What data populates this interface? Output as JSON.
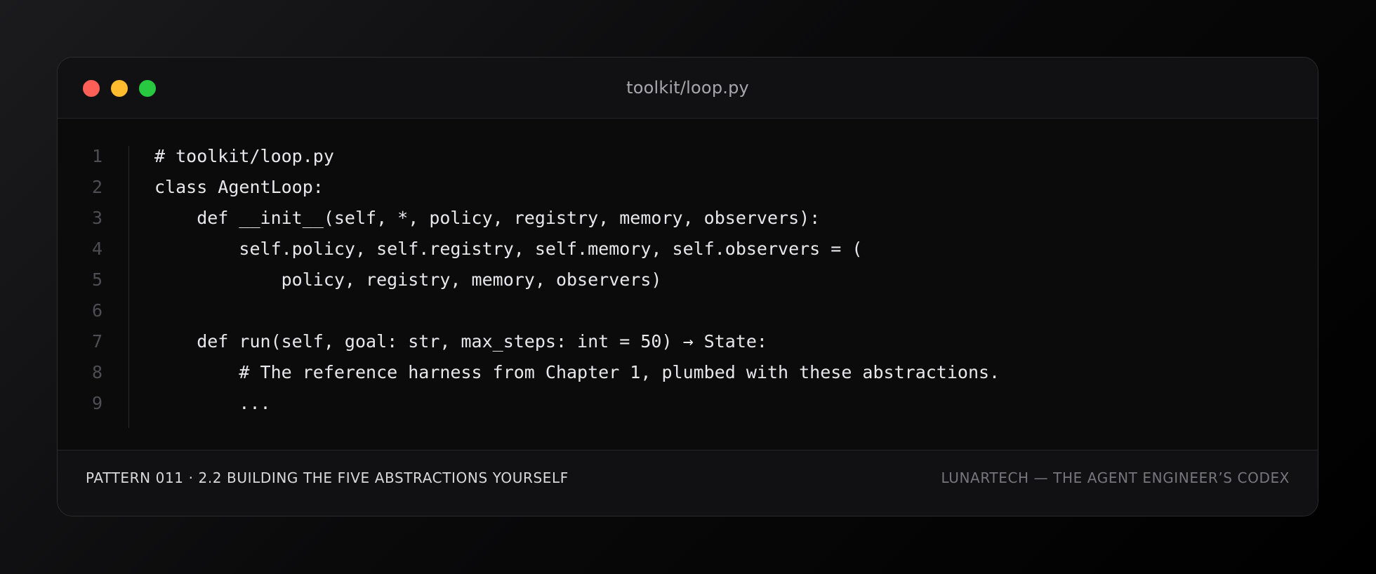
{
  "window": {
    "title": "toolkit/loop.py",
    "controls": [
      {
        "name": "close",
        "color": "#ff5f57"
      },
      {
        "name": "minimize",
        "color": "#febc2e"
      },
      {
        "name": "zoom",
        "color": "#28c840"
      }
    ]
  },
  "code": {
    "line_numbers": [
      "1",
      "2",
      "3",
      "4",
      "5",
      "6",
      "7",
      "8",
      "9"
    ],
    "lines": [
      "# toolkit/loop.py",
      "class AgentLoop:",
      "    def __init__(self, *, policy, registry, memory, observers):",
      "        self.policy, self.registry, self.memory, self.observers = (",
      "            policy, registry, memory, observers)",
      "",
      "    def run(self, goal: str, max_steps: int = 50) → State:",
      "        # The reference harness from Chapter 1, plumbed with these abstractions.",
      "        ..."
    ]
  },
  "footer": {
    "left": "PATTERN 011 · 2.2 BUILDING THE FIVE ABSTRACTIONS YOURSELF",
    "right": "LUNARTECH — THE AGENT ENGINEER’S CODEX"
  },
  "colors": {
    "code_text": "#e8e8ea",
    "line_number": "#4d4d53",
    "title": "#a7a7ad"
  }
}
